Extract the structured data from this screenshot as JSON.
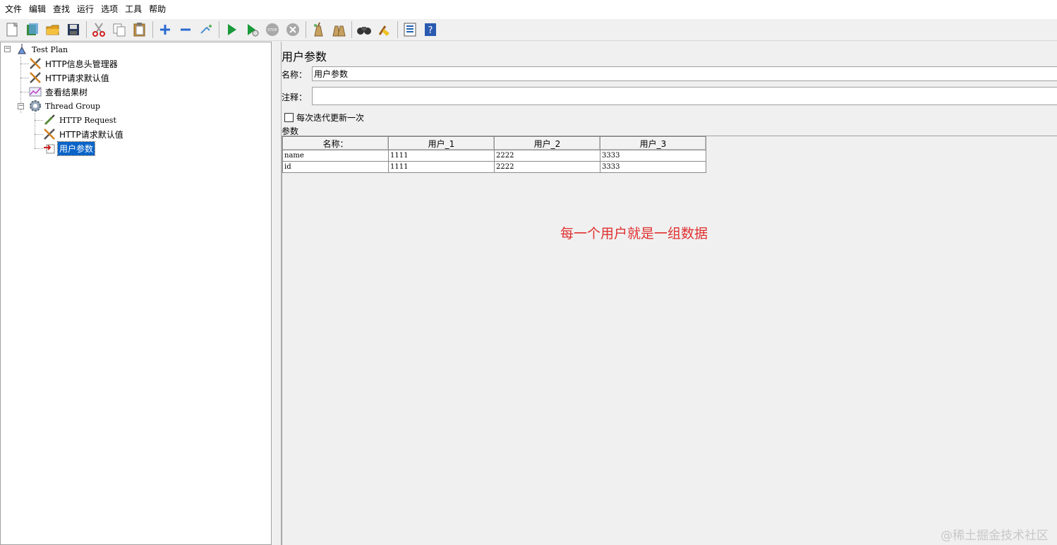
{
  "menu": [
    "文件",
    "编辑",
    "查找",
    "运行",
    "选项",
    "工具",
    "帮助"
  ],
  "toolbar": [
    "new-icon",
    "templates-icon",
    "open-icon",
    "save-icon",
    "cut-icon",
    "copy-icon",
    "paste-icon",
    "expand-icon",
    "collapse-icon",
    "toggle-icon",
    "start-icon",
    "start-no-pause-icon",
    "stop-icon",
    "shutdown-icon",
    "clear-icon",
    "clear-all-icon",
    "search-icon",
    "reset-search-icon",
    "function-helper-icon",
    "help-icon"
  ],
  "tree": {
    "items": [
      {
        "label": "Test Plan",
        "icon": "test-plan-icon"
      },
      {
        "label": "HTTP信息头管理器",
        "icon": "wrench-icon"
      },
      {
        "label": "HTTP请求默认值",
        "icon": "wrench-icon"
      },
      {
        "label": "查看结果树",
        "icon": "listener-graph-icon"
      },
      {
        "label": "Thread Group",
        "icon": "gear-icon"
      },
      {
        "label": "HTTP Request",
        "icon": "sampler-pipette-icon"
      },
      {
        "label": "HTTP请求默认值",
        "icon": "wrench-icon"
      },
      {
        "label": "用户参数",
        "icon": "preprocessor-icon"
      }
    ]
  },
  "panel": {
    "title": "用户参数",
    "name_label": "名称：",
    "name_value": "用户参数",
    "comment_label": "注释：",
    "comment_value": "",
    "checkbox_label": "每次迭代更新一次",
    "checkbox_checked": false,
    "params_label": "参数"
  },
  "table": {
    "headers": [
      "名称：",
      "用户_1",
      "用户_2",
      "用户_3"
    ],
    "rows": [
      [
        "name",
        "1111",
        "2222",
        "3333"
      ],
      [
        "id",
        "1111",
        "2222",
        "3333"
      ]
    ]
  },
  "annotation": "每一个用户就是一组数据",
  "watermark": "@稀土掘金技术社区",
  "colors": {
    "selection": "#0a64c8",
    "annotation": "#e03030"
  }
}
